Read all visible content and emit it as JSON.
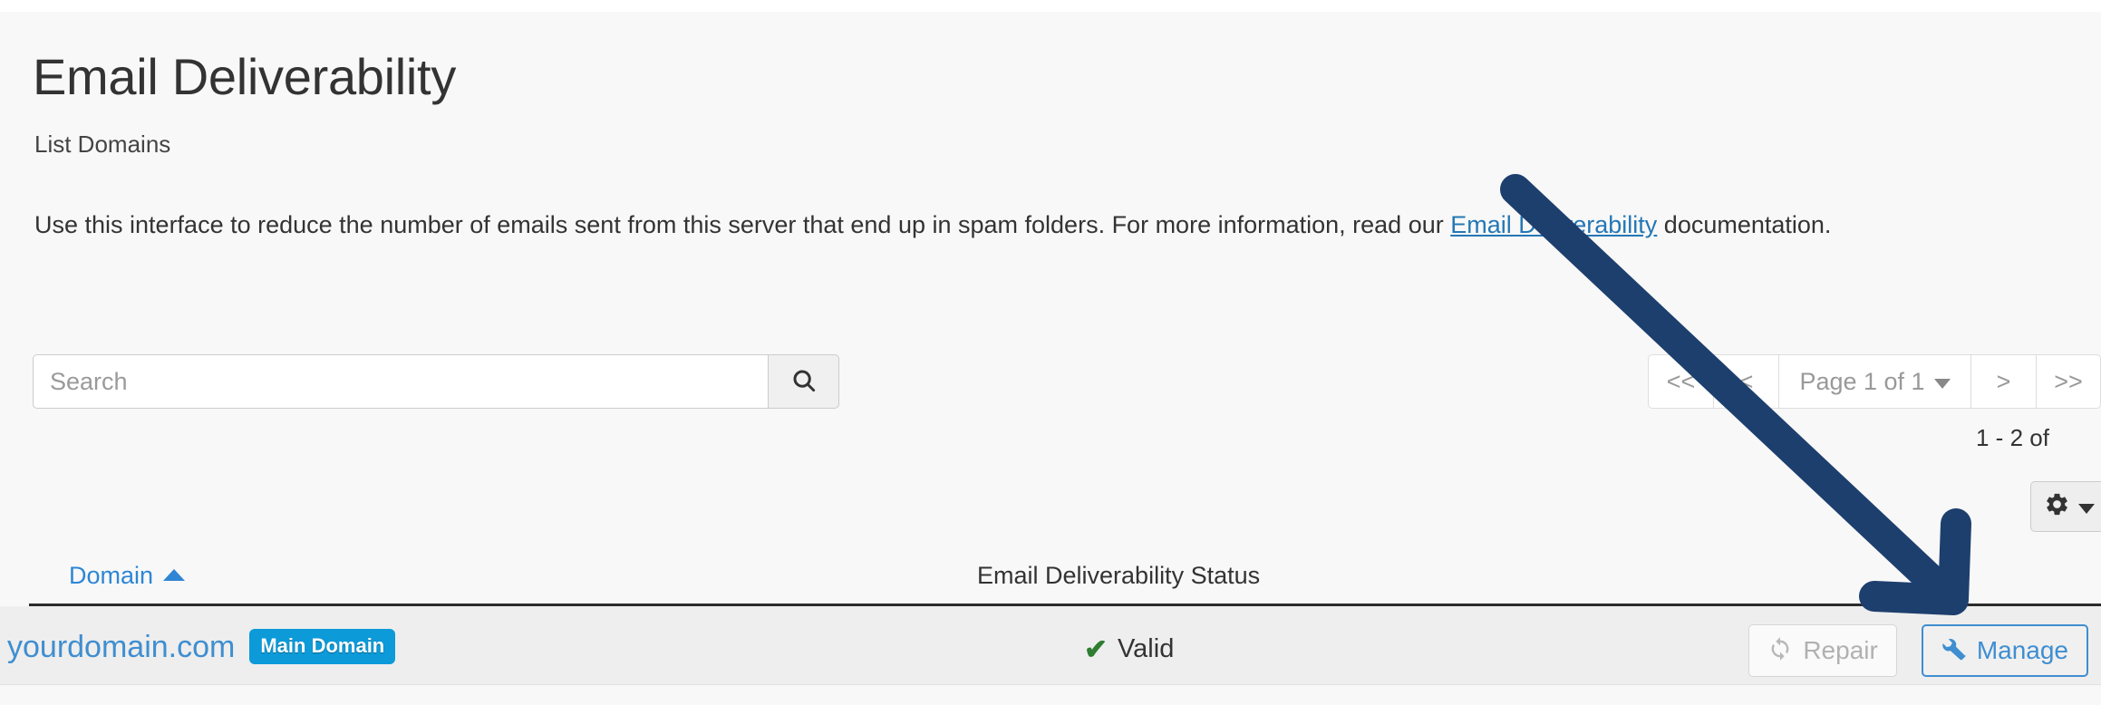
{
  "header": {
    "title": "Email Deliverability",
    "subtitle": "List Domains",
    "description_before": "Use this interface to reduce the number of emails sent from this server that end up in spam folders. For more information, read our ",
    "description_link": "Email Deliverability",
    "description_after": " documentation."
  },
  "search": {
    "placeholder": "Search",
    "value": "",
    "icon": "search-icon"
  },
  "pagination": {
    "first_label": "<<",
    "prev_label": "<",
    "page_label": "Page 1 of 1",
    "next_label": ">",
    "last_label": ">>",
    "record_count": "1 - 2 of"
  },
  "settings": {
    "icon": "gear-icon",
    "caret": "chevron-down-icon"
  },
  "table": {
    "columns": [
      {
        "label": "Domain",
        "sort": "ascending",
        "sortable": true
      },
      {
        "label": "Email Deliverability Status",
        "sortable": false
      }
    ],
    "rows": [
      {
        "domain": "yourdomain.com",
        "badge": "Main Domain",
        "status": "Valid",
        "status_icon": "check-icon",
        "actions": [
          {
            "label": "Repair",
            "icon": "refresh-icon",
            "disabled": true
          },
          {
            "label": "Manage",
            "icon": "wrench-icon",
            "disabled": false
          }
        ]
      }
    ]
  },
  "colors": {
    "link": "#2477b5",
    "domain_link": "#3f8ed0",
    "badge_bg": "#0c9ad9",
    "status_valid": "#2e7d32",
    "annotation_arrow": "#1d3f6e",
    "manage_border": "#3f8ed0"
  }
}
